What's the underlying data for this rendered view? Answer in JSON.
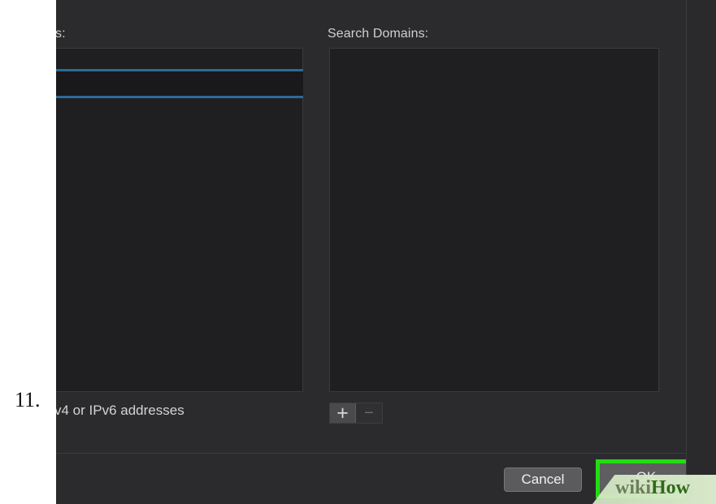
{
  "step": {
    "number": "11."
  },
  "dialog": {
    "dns_label_visible": "s:",
    "search_domains_label": "Search Domains:",
    "hint_text_visible": "v4 or IPv6 addresses",
    "stepper": {
      "plus_label": "+",
      "minus_label": "−"
    },
    "buttons": {
      "cancel": "Cancel",
      "ok": "OK"
    }
  },
  "watermark": {
    "wiki": "wiki",
    "how": "How"
  },
  "colors": {
    "background": "#2b2b2d",
    "list_background": "#1f1f21",
    "selection_outline": "#2c6b97",
    "ok_highlight": "#22dd11",
    "text": "#cfcfd1"
  }
}
